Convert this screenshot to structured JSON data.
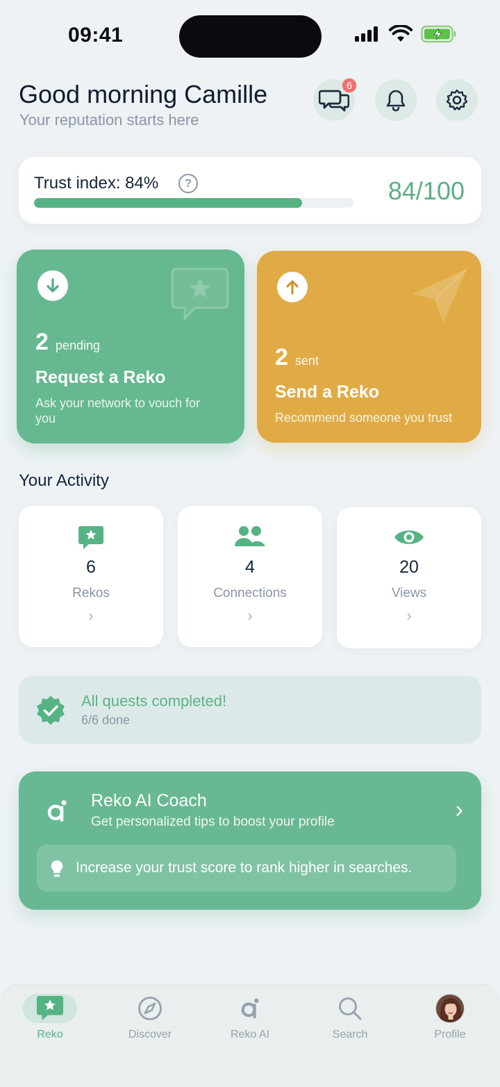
{
  "status_bar": {
    "time": "09:41"
  },
  "header": {
    "greeting": "Good morning Camille",
    "subtitle": "Your reputation starts here",
    "messages_badge": "6"
  },
  "trust": {
    "label": "Trust index: 84%",
    "help": "?",
    "progress": 0.84,
    "score": "84/100"
  },
  "request_card": {
    "count": "2",
    "count_label": "pending",
    "title": "Request a Reko",
    "description": "Ask your network to vouch for you"
  },
  "send_card": {
    "count": "2",
    "count_label": "sent",
    "title": "Send a Reko",
    "description": "Recommend someone you trust"
  },
  "activity": {
    "title": "Your Activity",
    "stats": [
      {
        "value": "6",
        "label": "Rekos",
        "icon": "chat-star-icon"
      },
      {
        "value": "4",
        "label": "Connections",
        "icon": "people-icon"
      },
      {
        "value": "20",
        "label": "Views",
        "icon": "eye-icon"
      }
    ],
    "chevron": "›"
  },
  "quests": {
    "title": "All quests completed!",
    "subtitle": "6/6 done"
  },
  "coach": {
    "title": "Reko AI Coach",
    "subtitle": "Get personalized tips to boost your profile",
    "tip": "Increase your trust score to rank higher in searches.",
    "chevron": "›"
  },
  "tabs": [
    {
      "label": "Reko",
      "icon": "chat-star-icon",
      "active": true
    },
    {
      "label": "Discover",
      "icon": "compass-icon",
      "active": false
    },
    {
      "label": "Reko AI",
      "icon": "reko-ai-icon",
      "active": false
    },
    {
      "label": "Search",
      "icon": "search-icon",
      "active": false
    },
    {
      "label": "Profile",
      "icon": "avatar",
      "active": false
    }
  ],
  "colors": {
    "accent_green": "#56b384",
    "request_card": "#66b890",
    "send_card": "#e0ab45",
    "badge_red": "#f26d6d"
  }
}
